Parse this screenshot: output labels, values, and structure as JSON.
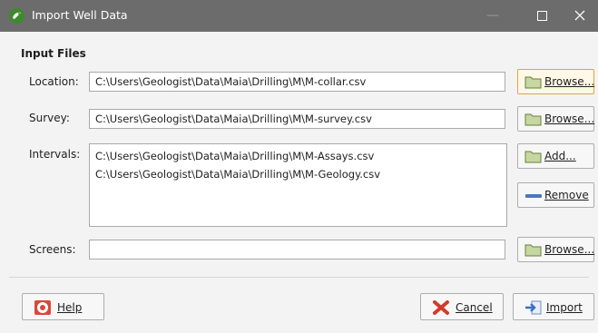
{
  "window": {
    "title": "Import Well Data",
    "icons": {
      "app": "leapfrog-app-icon",
      "minimize": "minimize-icon",
      "maximize": "maximize-icon",
      "close": "close-icon"
    }
  },
  "input_files": {
    "section_title": "Input Files",
    "location": {
      "label": "Location:",
      "value": "C:\\Users\\Geologist\\Data\\Maia\\Drilling\\M\\M-collar.csv",
      "button": "Browse..."
    },
    "survey": {
      "label": "Survey:",
      "value": "C:\\Users\\Geologist\\Data\\Maia\\Drilling\\M\\M-survey.csv",
      "button": "Browse..."
    },
    "intervals": {
      "label": "Intervals:",
      "items": [
        "C:\\Users\\Geologist\\Data\\Maia\\Drilling\\M\\M-Assays.csv",
        "C:\\Users\\Geologist\\Data\\Maia\\Drilling\\M\\M-Geology.csv"
      ],
      "add_button": "Add...",
      "remove_button": "Remove"
    },
    "screens": {
      "label": "Screens:",
      "value": "",
      "button": "Browse..."
    }
  },
  "footer": {
    "help": "Help",
    "cancel": "Cancel",
    "import": "Import"
  },
  "colors": {
    "titlebar": "#6c6c6c",
    "focus_border": "#e0a63a",
    "remove_icon": "#4a78c2",
    "cancel_icon": "#d23b2b"
  }
}
